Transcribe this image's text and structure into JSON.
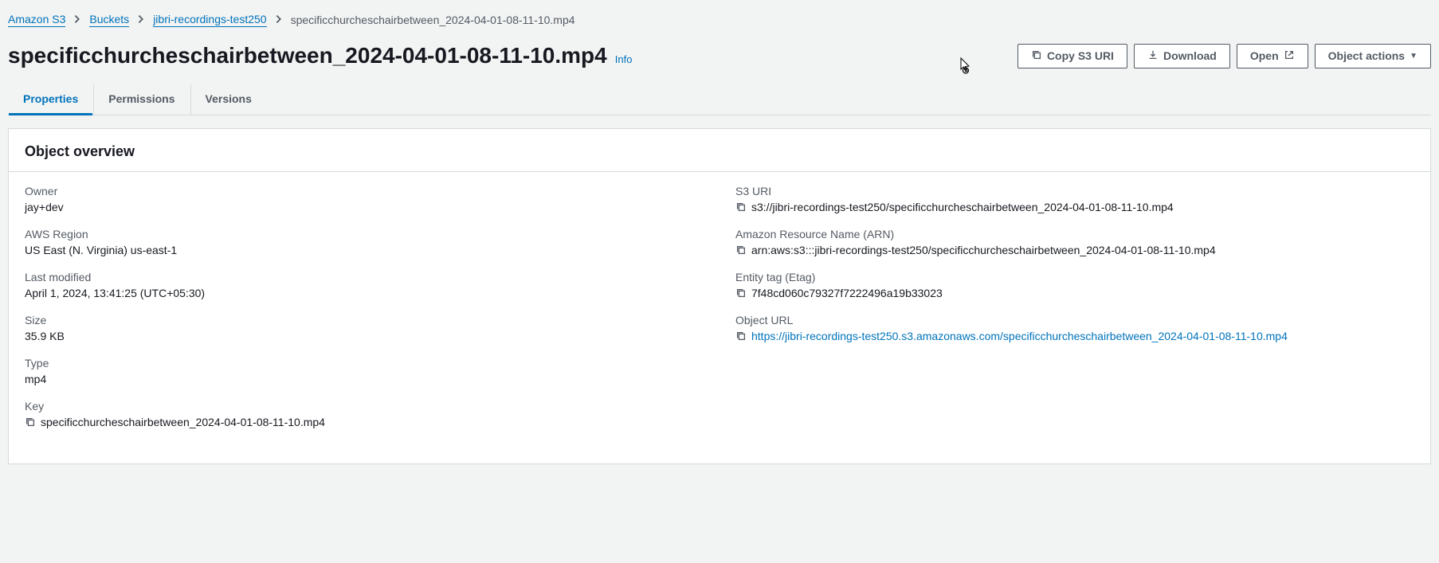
{
  "breadcrumb": {
    "root": "Amazon S3",
    "buckets": "Buckets",
    "bucket": "jibri-recordings-test250",
    "current": "specificchurcheschairbetween_2024-04-01-08-11-10.mp4"
  },
  "header": {
    "title": "specificchurcheschairbetween_2024-04-01-08-11-10.mp4",
    "info": "Info"
  },
  "actions": {
    "copy_uri": "Copy S3 URI",
    "download": "Download",
    "open": "Open",
    "object_actions": "Object actions"
  },
  "tabs": {
    "properties": "Properties",
    "permissions": "Permissions",
    "versions": "Versions"
  },
  "overview": {
    "title": "Object overview",
    "owner_label": "Owner",
    "owner": "jay+dev",
    "region_label": "AWS Region",
    "region": "US East (N. Virginia) us-east-1",
    "modified_label": "Last modified",
    "modified": "April 1, 2024, 13:41:25 (UTC+05:30)",
    "size_label": "Size",
    "size": "35.9 KB",
    "type_label": "Type",
    "type": "mp4",
    "key_label": "Key",
    "key": "specificchurcheschairbetween_2024-04-01-08-11-10.mp4",
    "s3uri_label": "S3 URI",
    "s3uri": "s3://jibri-recordings-test250/specificchurcheschairbetween_2024-04-01-08-11-10.mp4",
    "arn_label": "Amazon Resource Name (ARN)",
    "arn": "arn:aws:s3:::jibri-recordings-test250/specificchurcheschairbetween_2024-04-01-08-11-10.mp4",
    "etag_label": "Entity tag (Etag)",
    "etag": "7f48cd060c79327f7222496a19b33023",
    "url_label": "Object URL",
    "url": "https://jibri-recordings-test250.s3.amazonaws.com/specificchurcheschairbetween_2024-04-01-08-11-10.mp4"
  }
}
